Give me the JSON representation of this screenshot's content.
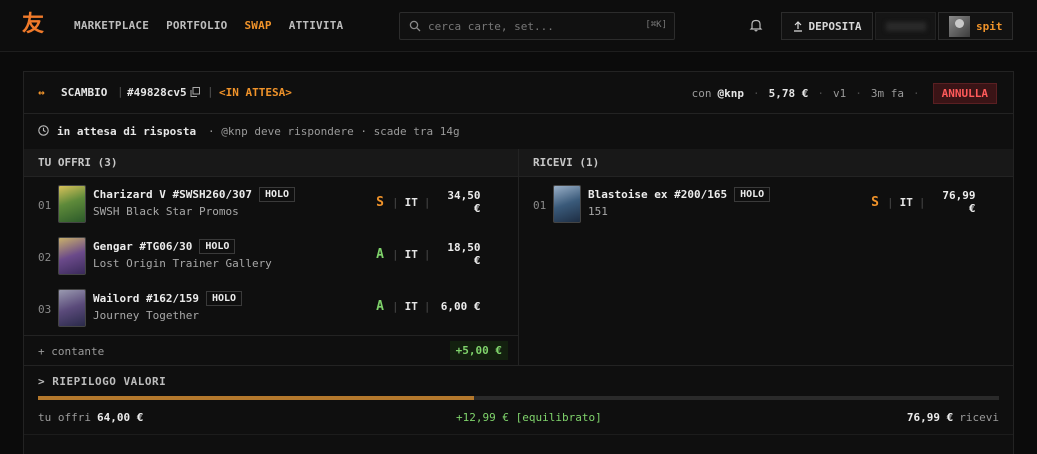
{
  "nav": {
    "logo": "友",
    "links": [
      {
        "label": "MARKETPLACE",
        "active": false
      },
      {
        "label": "PORTFOLIO",
        "active": false
      },
      {
        "label": "SWAP",
        "active": true
      },
      {
        "label": "ATTIVITA",
        "active": false
      }
    ],
    "search_placeholder": "cerca carte, set...",
    "search_shortcut": "[⌘K]",
    "deposit_label": "DEPOSITA",
    "username": "spit"
  },
  "trade": {
    "type_label": "SCAMBIO",
    "id": "#49828cv5",
    "status": "<IN ATTESA>",
    "with_prefix": "con",
    "counterparty": "@knp",
    "amount": "5,78 €",
    "version": "v1",
    "time": "3m fa",
    "cancel_label": "ANNULLA",
    "waiting_title": "in attesa di risposta",
    "waiting_detail": "· @knp deve rispondere · scade tra 14g"
  },
  "offer": {
    "header": "TU OFFRI (3)",
    "items": [
      {
        "index": "01",
        "name": "Charizard V #SWSH260/307",
        "badge": "HOLO",
        "set": "SWSH Black Star Promos",
        "grade": "S",
        "lang": "IT",
        "price": "34,50 €"
      },
      {
        "index": "02",
        "name": "Gengar #TG06/30",
        "badge": "HOLO",
        "set": "Lost Origin Trainer Gallery",
        "grade": "A",
        "lang": "IT",
        "price": "18,50 €"
      },
      {
        "index": "03",
        "name": "Wailord #162/159",
        "badge": "HOLO",
        "set": "Journey Together",
        "grade": "A",
        "lang": "IT",
        "price": "6,00 €"
      }
    ],
    "cash_label": "+ contante",
    "cash_value": "+5,00 €"
  },
  "receive": {
    "header": "RICEVI (1)",
    "items": [
      {
        "index": "01",
        "name": "Blastoise ex #200/165",
        "badge": "HOLO",
        "set": "151",
        "grade": "S",
        "lang": "IT",
        "price": "76,99 €"
      }
    ]
  },
  "summary": {
    "header": "> RIEPILOGO VALORI",
    "offer_label": "tu offri",
    "offer_value": "64,00 €",
    "diff": "+12,99 € [equilibrato]",
    "receive_value": "76,99 €",
    "receive_label": "ricevi",
    "offer_share": 0.454
  },
  "colors": {
    "accent": "#f0932a",
    "positive": "#7fd36b",
    "danger": "#ff5a5a"
  }
}
